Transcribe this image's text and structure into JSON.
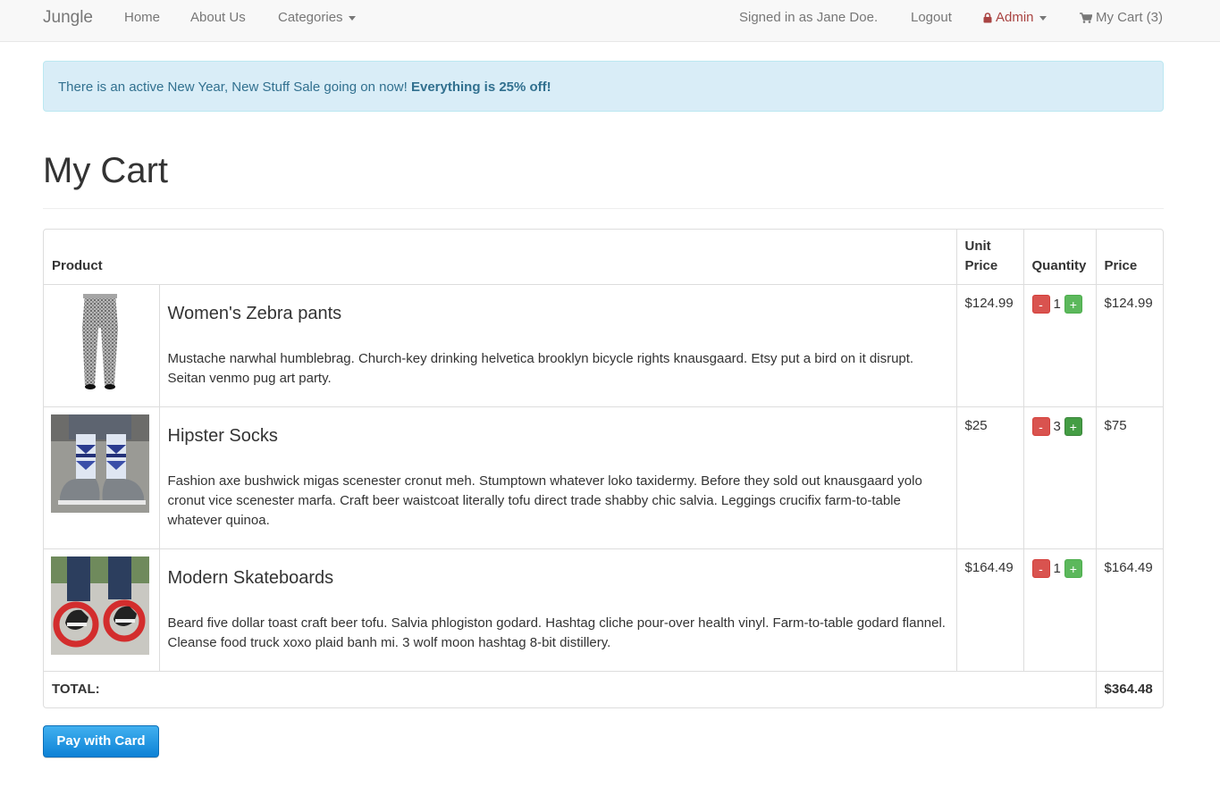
{
  "navbar": {
    "brand": "Jungle",
    "links": {
      "home": "Home",
      "about": "About Us",
      "categories": "Categories"
    },
    "signed_in": "Signed in as Jane Doe.",
    "logout": "Logout",
    "admin": "Admin",
    "cart": "My Cart (3)"
  },
  "alert": {
    "text": "There is an active New Year, New Stuff Sale going on now! ",
    "bold": "Everything is 25% off!"
  },
  "page": {
    "title": "My Cart"
  },
  "table": {
    "headers": {
      "product": "Product",
      "unit_price": "Unit Price",
      "quantity": "Quantity",
      "price": "Price"
    },
    "items": [
      {
        "name": "Women's Zebra pants",
        "description": "Mustache narwhal humblebrag. Church-key drinking helvetica brooklyn bicycle rights knausgaard. Etsy put a bird on it disrupt. Seitan venmo pug art party.",
        "unit_price": "$124.99",
        "quantity": "1",
        "price": "$124.99"
      },
      {
        "name": "Hipster Socks",
        "description": "Fashion axe bushwick migas scenester cronut meh. Stumptown whatever loko taxidermy. Before they sold out knausgaard yolo cronut vice scenester marfa. Craft beer waistcoat literally tofu direct trade shabby chic salvia. Leggings crucifix farm-to-table whatever quinoa.",
        "unit_price": "$25",
        "quantity": "3",
        "price": "$75"
      },
      {
        "name": "Modern Skateboards",
        "description": "Beard five dollar toast craft beer tofu. Salvia phlogiston godard. Hashtag cliche pour-over health vinyl. Farm-to-table godard flannel. Cleanse food truck xoxo plaid banh mi. 3 wolf moon hashtag 8-bit distillery.",
        "unit_price": "$164.49",
        "quantity": "1",
        "price": "$164.49"
      }
    ],
    "minus_label": "-",
    "plus_label": "+",
    "total_label": "TOTAL:",
    "total_value": "$364.48"
  },
  "pay_button": "Pay with Card",
  "colors": {
    "alert_bg": "#d9edf7",
    "alert_text": "#31708f",
    "admin": "#a94442",
    "minus_btn": "#d9534f",
    "plus_btn": "#5cb85c",
    "pay_btn": "#1a8fdf"
  },
  "icons": {
    "admin": "lock-icon",
    "cart": "shopping-cart-icon",
    "dropdown": "caret-down-icon"
  }
}
